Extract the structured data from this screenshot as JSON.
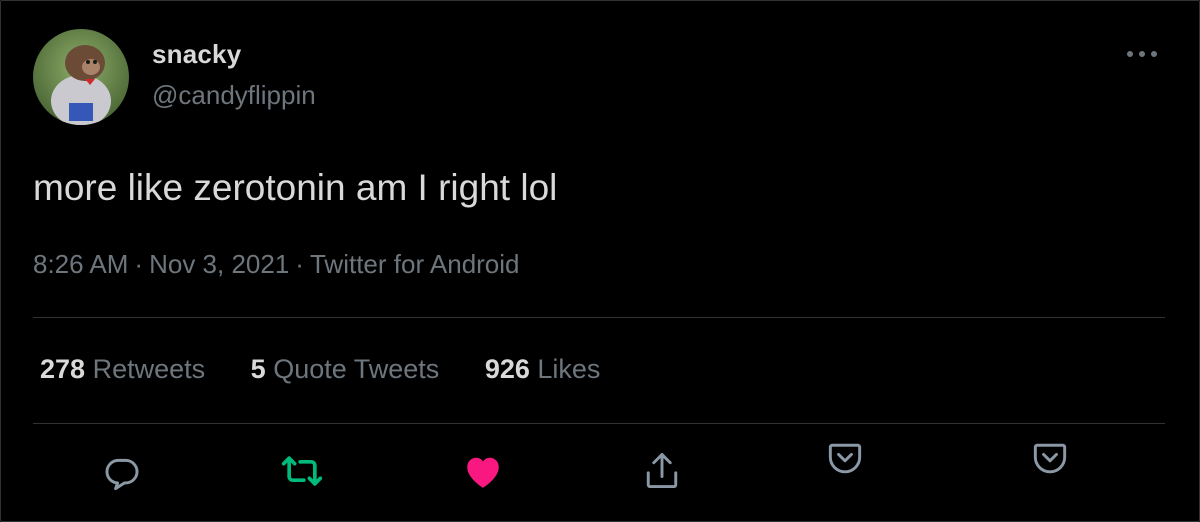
{
  "author": {
    "display_name": "snacky",
    "handle": "@candyflippin"
  },
  "tweet": {
    "text": "more like zerotonin am I right lol",
    "time": "8:26 AM",
    "date": "Nov 3, 2021",
    "source": "Twitter for Android",
    "separator": "·"
  },
  "stats": {
    "retweets": {
      "count": "278",
      "label": "Retweets"
    },
    "quotes": {
      "count": "5",
      "label": "Quote Tweets"
    },
    "likes": {
      "count": "926",
      "label": "Likes"
    }
  },
  "actions": [
    "reply-icon",
    "retweet-icon",
    "like-icon",
    "share-icon",
    "save-icon",
    "save-icon"
  ],
  "colors": {
    "background": "#000000",
    "text": "#d9d9d9",
    "muted": "#6e767d",
    "divider": "#2f3336",
    "retweet_active": "#00ba7c",
    "like_active": "#f91880"
  }
}
